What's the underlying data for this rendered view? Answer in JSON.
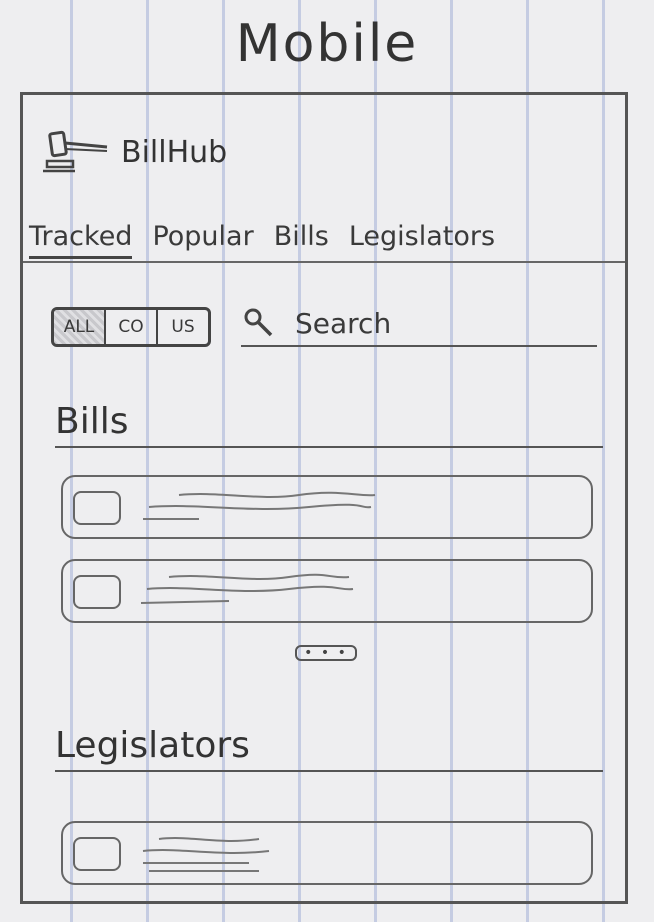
{
  "page_title": "Mobile",
  "app": {
    "name": "BillHub",
    "logo_icon": "gavel-icon"
  },
  "tabs": [
    {
      "label": "Tracked",
      "active": true
    },
    {
      "label": "Popular",
      "active": false
    },
    {
      "label": "Bills",
      "active": false
    },
    {
      "label": "Legislators",
      "active": false
    }
  ],
  "filter": {
    "options": [
      "ALL",
      "CO",
      "US"
    ],
    "selected": "ALL"
  },
  "search": {
    "placeholder": "Search",
    "icon": "search-icon"
  },
  "sections": {
    "bills": {
      "heading": "Bills"
    },
    "legislators": {
      "heading": "Legislators"
    }
  },
  "more": {
    "label": "• • •"
  }
}
